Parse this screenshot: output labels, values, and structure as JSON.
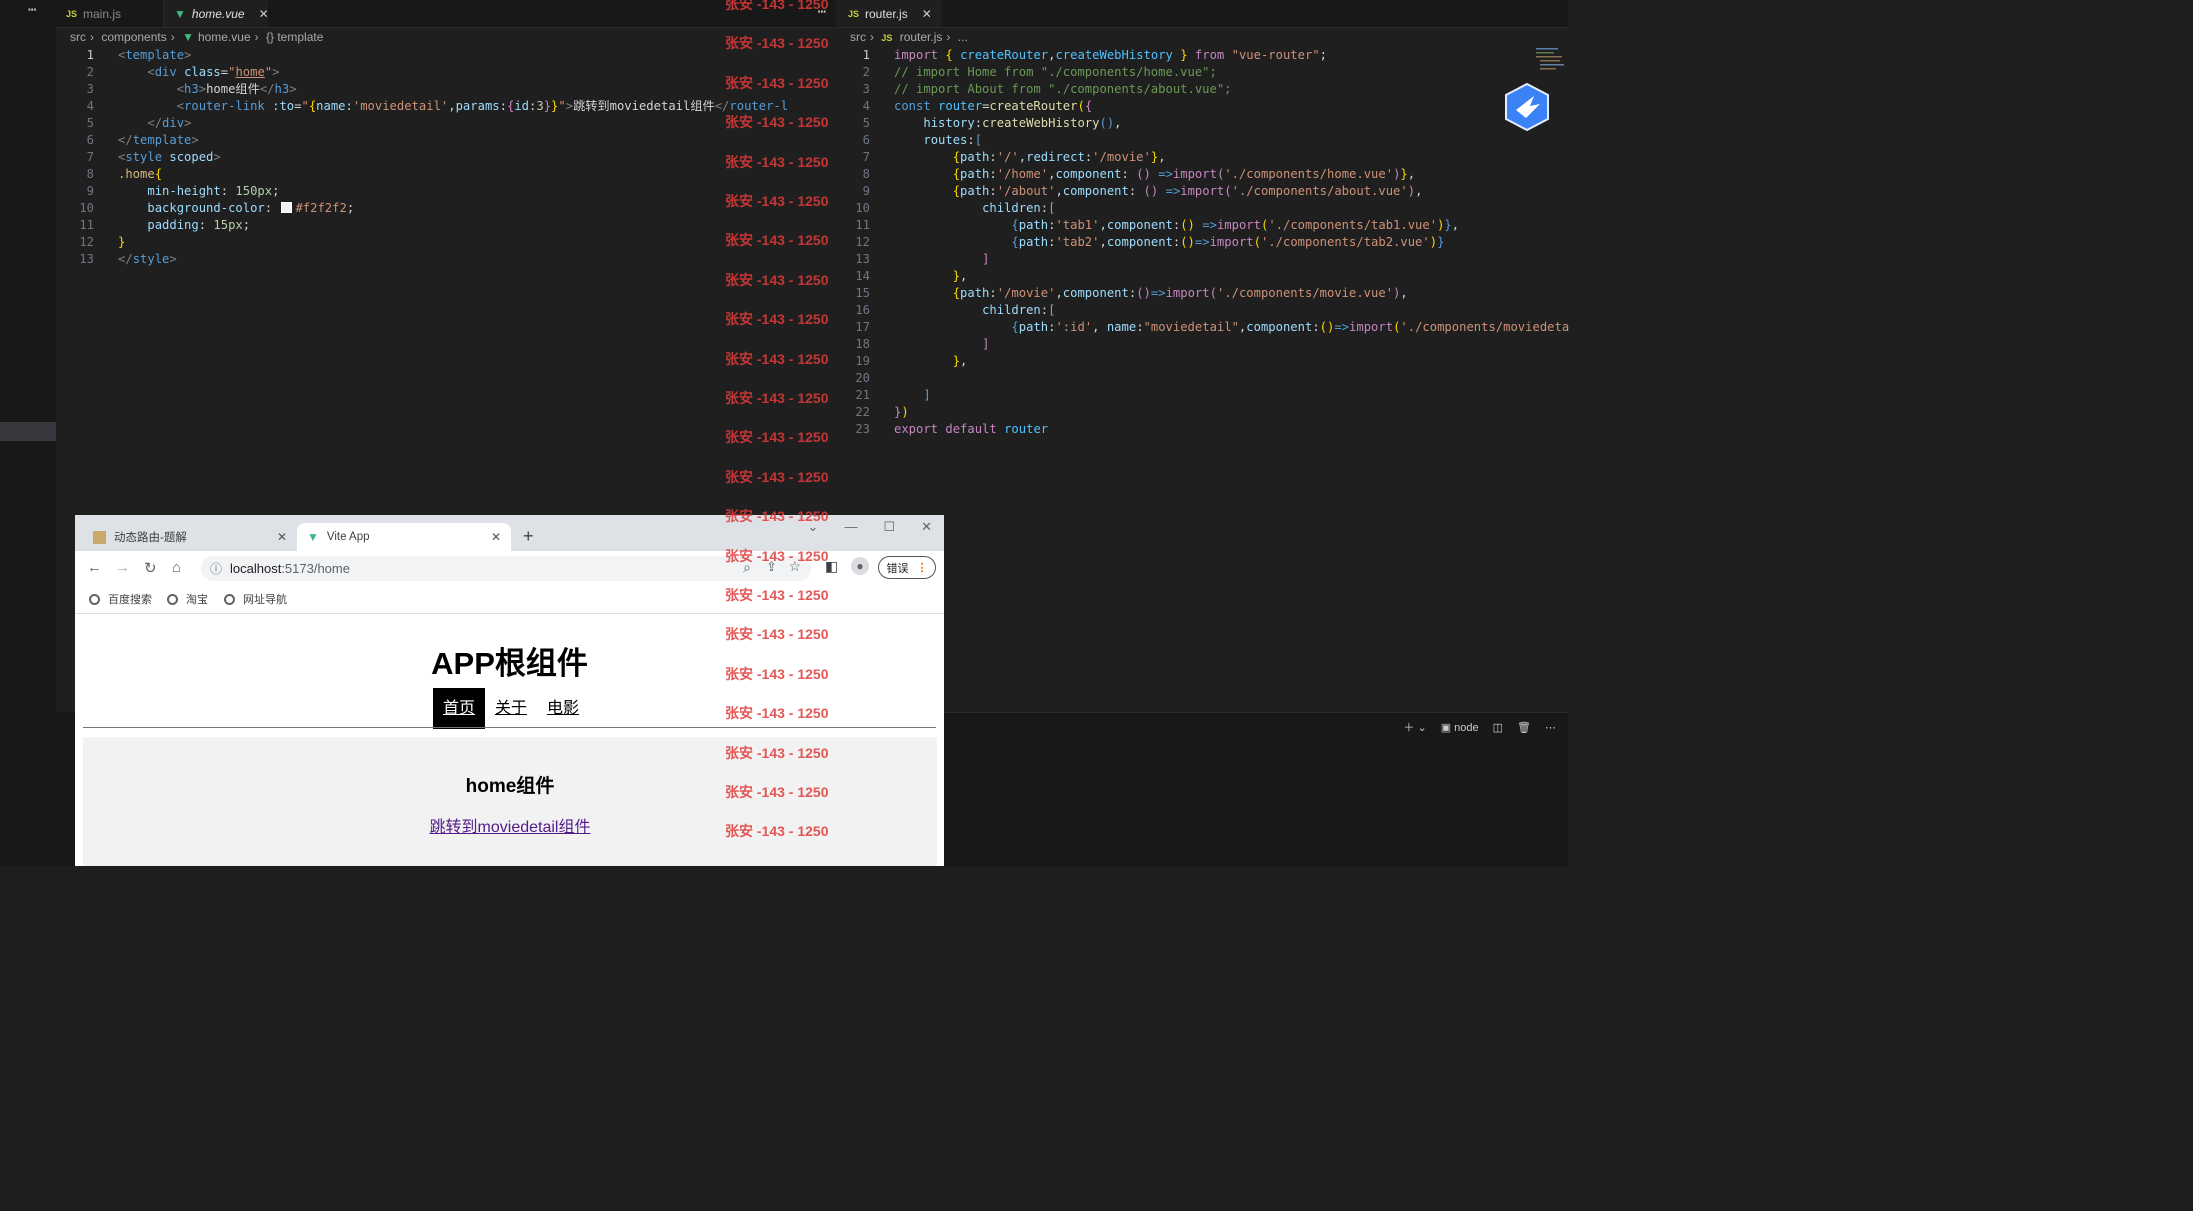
{
  "editor_left": {
    "tabs": [
      {
        "label": "main.js",
        "icon": "JS",
        "active": false
      },
      {
        "label": "home.vue",
        "icon": "vue",
        "active": true
      }
    ],
    "breadcrumb": [
      "src",
      "components",
      "home.vue",
      "{} template"
    ],
    "line_numbers": [
      "1",
      "2",
      "3",
      "4",
      "5",
      "6",
      "7",
      "8",
      "9",
      "10",
      "11",
      "12",
      "13"
    ]
  },
  "editor_right": {
    "tabs": [
      {
        "label": "router.js",
        "icon": "JS",
        "active": true
      }
    ],
    "breadcrumb": [
      "src",
      "router.js",
      "..."
    ],
    "line_numbers": [
      "1",
      "2",
      "3",
      "4",
      "5",
      "6",
      "7",
      "8",
      "9",
      "10",
      "11",
      "12",
      "13",
      "14",
      "15",
      "16",
      "17",
      "18",
      "19",
      "20",
      "21",
      "22",
      "23"
    ]
  },
  "watermark": {
    "text": "张安 -143 - 1250"
  },
  "panel": {
    "terminal_label": "node"
  },
  "browser": {
    "tabs": [
      {
        "label": "动态路由-题解"
      },
      {
        "label": "Vite App"
      }
    ],
    "url_host": "localhost",
    "url_path": ":5173/home",
    "error_button": "错误",
    "bookmarks": [
      "百度搜索",
      "淘宝",
      "网址导航"
    ],
    "page": {
      "title": "APP根组件",
      "nav": [
        "首页",
        "关于",
        "电影"
      ],
      "active_nav": "首页",
      "home_heading": "home组件",
      "home_link": "跳转到moviedetail组件"
    }
  },
  "colors": {
    "editor_bg": "#1f1f1f",
    "watermark": "#e03b3b",
    "vue_green": "#41b883",
    "link_visited": "#551a8b"
  }
}
